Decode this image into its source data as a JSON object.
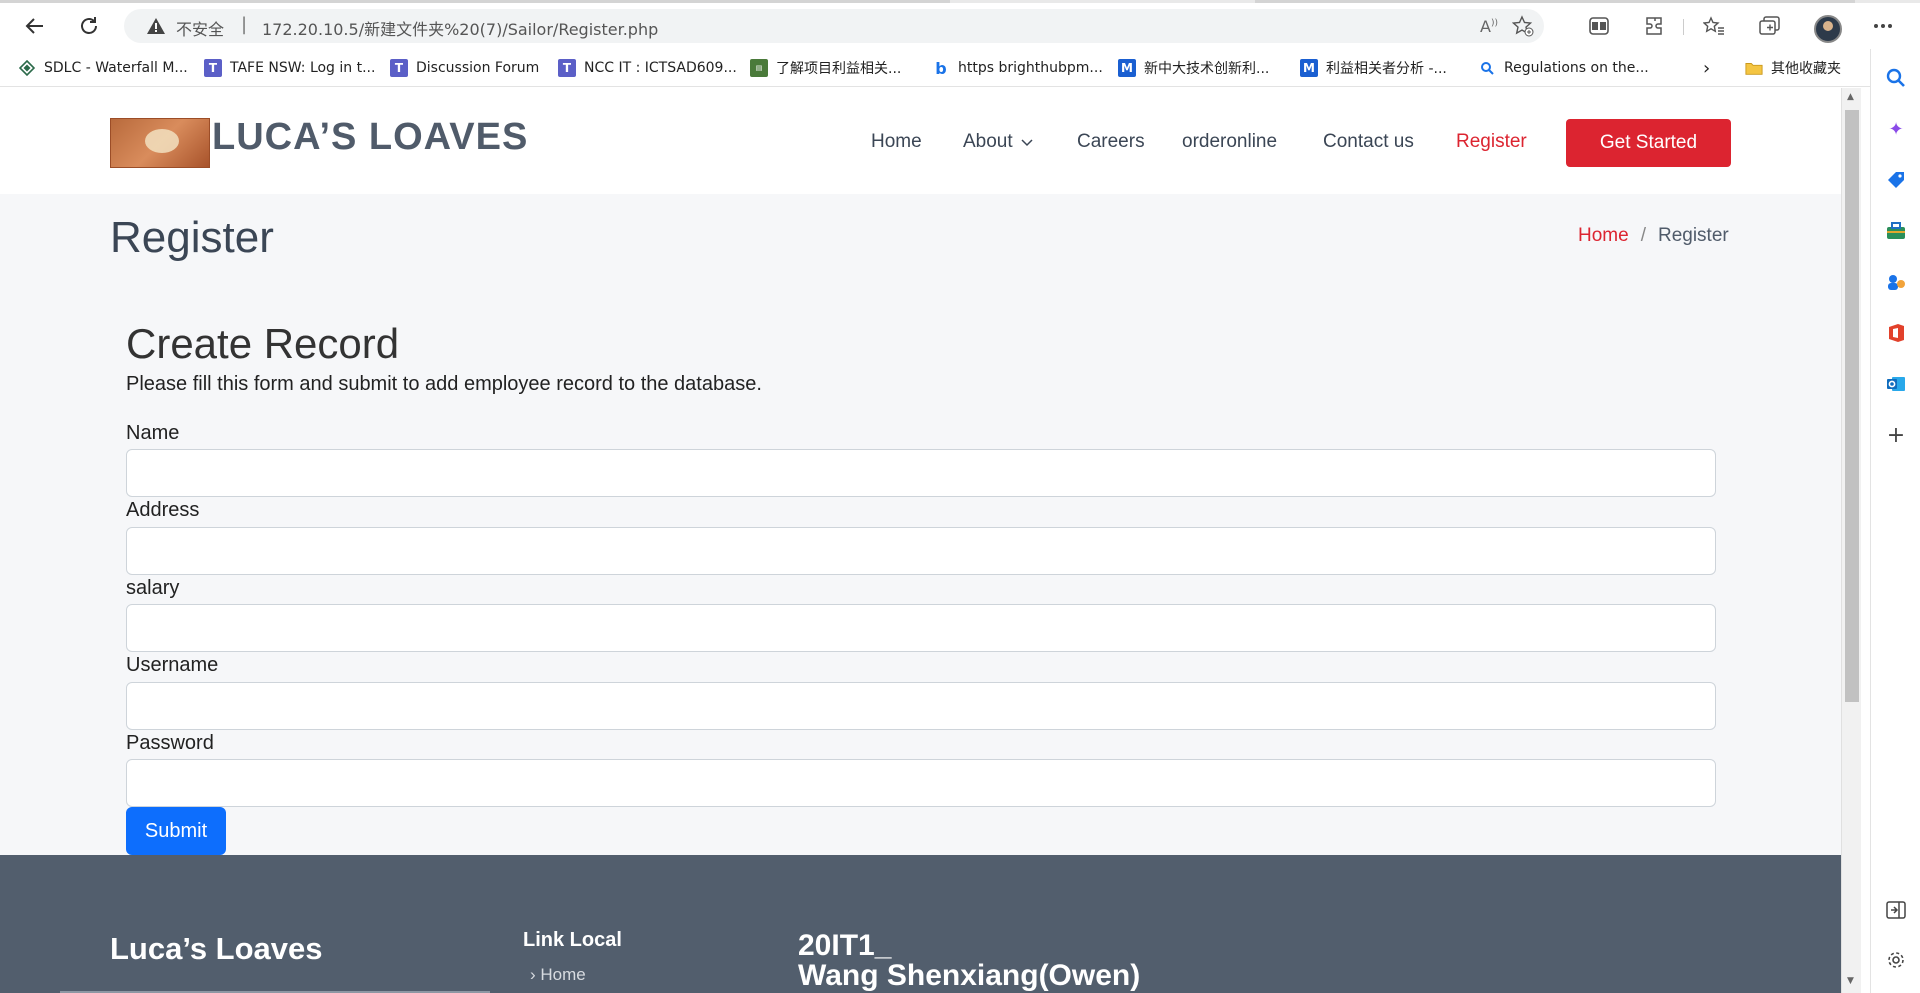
{
  "browser": {
    "insecure_label": "不安全",
    "url": "172.20.10.5/新建文件夹%20(7)/Sailor/Register.php",
    "favorites": [
      {
        "label": "SDLC - Waterfall M...",
        "icon": "diamond-icon"
      },
      {
        "label": "TAFE NSW: Log in t...",
        "icon": "teams-icon"
      },
      {
        "label": "Discussion Forum",
        "icon": "teams-icon"
      },
      {
        "label": "NCC IT : ICTSAD609...",
        "icon": "teams-icon"
      },
      {
        "label": "了解项目利益相关...",
        "icon": "book-icon"
      },
      {
        "label": "https brighthubpm...",
        "icon": "bing-icon"
      },
      {
        "label": "新中大技术创新利...",
        "icon": "m-icon"
      },
      {
        "label": "利益相关者分析 -...",
        "icon": "m-icon"
      },
      {
        "label": "Regulations on the...",
        "icon": "search-icon"
      }
    ],
    "other_favorites": "其他收藏夹"
  },
  "site": {
    "brand": "LUCA’S LOAVES",
    "menu": {
      "home": "Home",
      "about": "About",
      "careers": "Careers",
      "orderonline": "orderonline",
      "contact": "Contact us",
      "register": "Register",
      "cta": "Get Started"
    }
  },
  "page": {
    "title": "Register",
    "breadcrumb": {
      "home": "Home",
      "separator": "/",
      "current": "Register"
    }
  },
  "form": {
    "heading": "Create Record",
    "description": "Please fill this form and submit to add employee record to the database.",
    "fields": [
      {
        "label": "Name",
        "value": ""
      },
      {
        "label": "Address",
        "value": ""
      },
      {
        "label": "salary",
        "value": ""
      },
      {
        "label": "Username",
        "value": ""
      },
      {
        "label": "Password",
        "value": ""
      }
    ],
    "submit": "Submit"
  },
  "footer": {
    "brand": "Luca’s Loaves",
    "links_title": "Link Local",
    "link_home": "Home",
    "student_id": "20IT1_",
    "student_name": "Wang Shenxiang(Owen)"
  },
  "colors": {
    "accent": "#dc2430",
    "submit": "#0d6efd",
    "footer_bg": "#525e6d"
  }
}
